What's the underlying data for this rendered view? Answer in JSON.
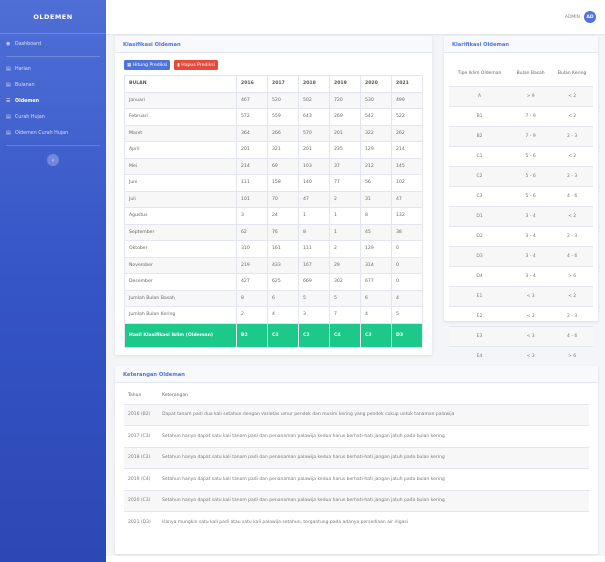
{
  "sidebar": {
    "brand": "OLDEMEN",
    "items": [
      {
        "label": "Dashboard",
        "icon": "dashboard-icon"
      },
      {
        "label": "Harian",
        "icon": "table-icon"
      },
      {
        "label": "Bulanan",
        "icon": "table-icon"
      },
      {
        "label": "Oldemen",
        "icon": "list-icon",
        "active": true
      },
      {
        "label": "Curah Hujan",
        "icon": "table-icon"
      },
      {
        "label": "Oldemen Curah Hujan",
        "icon": "table-icon"
      }
    ]
  },
  "topbar": {
    "user": "ADMIN",
    "avatar": "AD"
  },
  "main": {
    "title": "Klasifikasi Oldeman",
    "btn_hitung": "Hitung Prediksi",
    "btn_hapus": "Hapus Prediksi",
    "headers": [
      "BULAN",
      "2016",
      "2017",
      "2018",
      "2019",
      "2020",
      "2021"
    ],
    "rows": [
      [
        "Januari",
        "467",
        "520",
        "502",
        "720",
        "530",
        "499"
      ],
      [
        "Februari",
        "572",
        "559",
        "643",
        "269",
        "542",
        "522"
      ],
      [
        "Maret",
        "364",
        "266",
        "570",
        "201",
        "322",
        "262"
      ],
      [
        "April",
        "201",
        "321",
        "201",
        "235",
        "129",
        "214"
      ],
      [
        "Mei",
        "214",
        "69",
        "103",
        "37",
        "212",
        "145"
      ],
      [
        "Juni",
        "111",
        "158",
        "140",
        "77",
        "56",
        "102"
      ],
      [
        "Juli",
        "101",
        "70",
        "47",
        "2",
        "31",
        "47"
      ],
      [
        "Agustus",
        "3",
        "24",
        "1",
        "1",
        "8",
        "132"
      ],
      [
        "September",
        "62",
        "76",
        "8",
        "1",
        "45",
        "38"
      ],
      [
        "Oktober",
        "310",
        "161",
        "111",
        "2",
        "129",
        "0"
      ],
      [
        "November",
        "219",
        "433",
        "167",
        "29",
        "314",
        "0"
      ],
      [
        "Desember",
        "427",
        "625",
        "669",
        "302",
        "677",
        "0"
      ],
      [
        "Jumlah Bulan Basah",
        "8",
        "6",
        "5",
        "5",
        "6",
        "4"
      ],
      [
        "Jumlah Bulan Kering",
        "2",
        "4",
        "3",
        "7",
        "4",
        "5"
      ]
    ],
    "result": [
      "Hasil Klasifikasi Iklim (Oldeman)",
      "B2",
      "C3",
      "C2",
      "C4",
      "C3",
      "D3"
    ]
  },
  "side": {
    "title": "Klarifikasi Oldeman",
    "headers": [
      "Tipe Iklim Oldeman",
      "Bulan Basah",
      "Bulan Kering"
    ],
    "rows": [
      [
        "A",
        "> 9",
        "< 2"
      ],
      [
        "B1",
        "7 - 9",
        "< 2"
      ],
      [
        "B2",
        "7 - 9",
        "2 - 3"
      ],
      [
        "C1",
        "5 - 6",
        "< 2"
      ],
      [
        "C2",
        "5 - 6",
        "2 - 3"
      ],
      [
        "C3",
        "5 - 6",
        "4 - 6"
      ],
      [
        "D1",
        "3 - 4",
        "< 2"
      ],
      [
        "D2",
        "3 - 4",
        "2 - 3"
      ],
      [
        "D3",
        "3 - 4",
        "4 - 6"
      ],
      [
        "D4",
        "3 - 4",
        "> 6"
      ],
      [
        "E1",
        "< 3",
        "< 2"
      ],
      [
        "E2",
        "< 3",
        "2 - 3"
      ],
      [
        "E3",
        "< 3",
        "4 - 6"
      ],
      [
        "E4",
        "< 3",
        "> 6"
      ]
    ]
  },
  "ket": {
    "title": "Keterangan Oldeman",
    "headers": [
      "Tahun",
      "Keterangan"
    ],
    "rows": [
      [
        "2016 (B2)",
        "Dapat tanam padi dua kali setahun dengan varietas umur pendek dan musim kering yang pendek cukup untuk tanaman palawija"
      ],
      [
        "2017 (C3)",
        "Setahun hanya dapat satu kali tanam padi dan penanaman palawija kedua harus berhati-hati jangan jatuh pada bulan kering"
      ],
      [
        "2018 (C2)",
        "Setahun hanya dapat satu kali tanam padi dan penanaman palawija kedua harus berhati-hati jangan jatuh pada bulan kering"
      ],
      [
        "2019 (C4)",
        "Setahun hanya dapat satu kali tanam padi dan penanaman palawija kedua harus berhati-hati jangan jatuh pada bulan kering"
      ],
      [
        "2020 (C3)",
        "Setahun hanya dapat satu kali tanam padi dan penanaman palawija kedua harus berhati-hati jangan jatuh pada bulan kering"
      ],
      [
        "2021 (D3)",
        "Hanya mungkin satu kali padi atau satu kali palawija setahun, tergantung pada adanya persediaan air irigasi"
      ]
    ]
  }
}
